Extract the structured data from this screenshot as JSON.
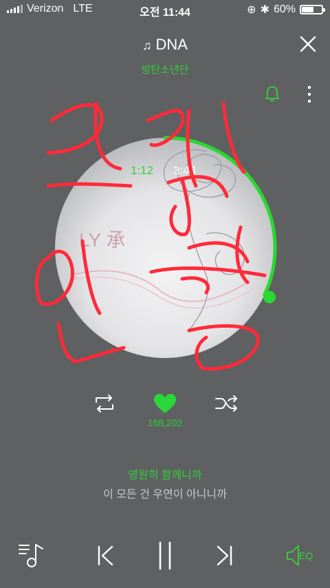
{
  "status": {
    "carrier": "Verizon",
    "network": "LTE",
    "time": "오전 11:44",
    "battery": "60%",
    "battery_level": 0.6
  },
  "track": {
    "title": "DNA",
    "artist": "방탄소년단",
    "current_time": "1:12",
    "total_time": "3:43",
    "progress": 0.32,
    "album_text": "LY 承"
  },
  "likes": "168,202",
  "lyrics": {
    "current": "영원히 함께니까",
    "next": "이 모든 건 우연이 아니니까"
  },
  "eq_label": "EQ",
  "colors": {
    "accent": "#38d13b",
    "background": "#5f6061"
  },
  "icons": [
    "note-icon",
    "close-icon",
    "bell-icon",
    "more-icon",
    "repeat-icon",
    "heart-icon",
    "shuffle-icon",
    "playlist-icon",
    "previous-icon",
    "pause-icon",
    "next-icon",
    "eq-icon"
  ]
}
